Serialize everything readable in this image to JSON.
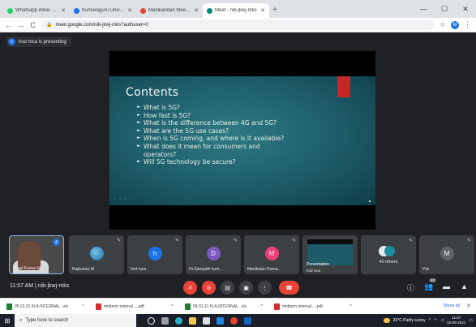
{
  "browser": {
    "tabs": [
      {
        "title": "Whatsapp inbox notification",
        "fav_color": "#25d366",
        "active": false
      },
      {
        "title": "Kumaraguru University Events",
        "fav_color": "#1a73e8",
        "active": false
      },
      {
        "title": "Manikandan Meet Dashboard",
        "fav_color": "#ea4335",
        "active": false
      },
      {
        "title": "Meet - nib-jkwj-mks",
        "fav_color": "#00897b",
        "active": true
      }
    ],
    "new_tab": "+",
    "window_controls": {
      "minimize": "—",
      "maximize": "☐",
      "close": "✕"
    },
    "url": "meet.google.com/nib-jkwj-mks?authuser=0",
    "back": "←",
    "forward": "→",
    "reload": "C",
    "profile_initial": "M"
  },
  "meet": {
    "presenter_chip": {
      "initial": "h",
      "text": "hod mca is presenting"
    },
    "slide": {
      "title": "Contents",
      "bullets": [
        "What is 5G?",
        "How fast is 5G?",
        "What is the difference between 4G and 5G?",
        "What are the 5G use cases?",
        "When is 5G coming, and where is it available?",
        "What does it mean for consumers and operators?",
        "Will 5G technology be secure?"
      ],
      "accent_color": "#c62828"
    },
    "participants": [
      {
        "name": "Vimal Kumar M",
        "type": "self"
      },
      {
        "name": "Rajkumar M",
        "type": "globe"
      },
      {
        "name": "hod mca",
        "initial": "h",
        "color": "#1a73e8"
      },
      {
        "name": "Dr.Sampath kum...",
        "initial": "D",
        "color": "#7e57c2"
      },
      {
        "name": "Manikalan Rama...",
        "initial": "M",
        "color": "#ec407a"
      },
      {
        "name": "hod mca",
        "type": "presentation",
        "title": "Presentation"
      },
      {
        "name": "40 others",
        "type": "others"
      },
      {
        "name": "You",
        "initial": "M",
        "color": "#5f6368"
      }
    ],
    "meeting_time": "11:57 AM",
    "meeting_code": "nib-jkwj-mks",
    "controls": {
      "mic": "✕",
      "camera": "⊘",
      "captions": "▤",
      "present": "▣",
      "more": "⋮",
      "end": "☎"
    },
    "right_icons": {
      "info": "ⓘ",
      "people": "👥",
      "people_count": "40",
      "chat": "▬",
      "activities": "▲"
    }
  },
  "downloads": {
    "items": [
      {
        "name": "05.01.21 III.A.INTERNAL...xls",
        "color": "#1e7e34"
      },
      {
        "name": "midterm internal ....pdf",
        "color": "#d32f2f"
      },
      {
        "name": "05.01.21 III.A.INTERNAL...xls",
        "color": "#1e7e34"
      },
      {
        "name": "midterm internal ....pdf",
        "color": "#d32f2f"
      }
    ],
    "show_all": "Show all",
    "close": "✕"
  },
  "taskbar": {
    "search_placeholder": "Type here to search",
    "weather": "33°C Partly sunny",
    "time": "11:57",
    "date": "02-05-2021"
  }
}
